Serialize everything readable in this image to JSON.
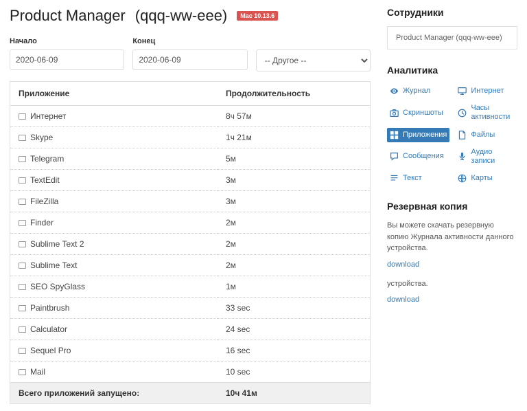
{
  "header": {
    "title": "Product Manager",
    "device_id": "(qqq-ww-eee)",
    "os_badge": "Mac 10.13.6"
  },
  "filters": {
    "start_label": "Начало",
    "start_value": "2020-06-09",
    "end_label": "Конец",
    "end_value": "2020-06-09",
    "other_value": "-- Другое --"
  },
  "table": {
    "col_app": "Приложение",
    "col_duration": "Продолжительность",
    "rows": [
      {
        "app": "Интернет",
        "dur": "8ч 57м"
      },
      {
        "app": "Skype",
        "dur": "1ч 21м"
      },
      {
        "app": "Telegram",
        "dur": "5м"
      },
      {
        "app": "TextEdit",
        "dur": "3м"
      },
      {
        "app": "FileZilla",
        "dur": "3м"
      },
      {
        "app": "Finder",
        "dur": "2м"
      },
      {
        "app": "Sublime Text 2",
        "dur": "2м"
      },
      {
        "app": "Sublime Text",
        "dur": "2м"
      },
      {
        "app": "SEO SpyGlass",
        "dur": "1м"
      },
      {
        "app": "Paintbrush",
        "dur": "33 sec"
      },
      {
        "app": "Calculator",
        "dur": "24 sec"
      },
      {
        "app": "Sequel Pro",
        "dur": "16 sec"
      },
      {
        "app": "Mail",
        "dur": "10 sec"
      }
    ],
    "total_label": "Всего приложений запущено:",
    "total_value": "10ч 41м"
  },
  "sidebar": {
    "employees_title": "Сотрудники",
    "employee_selected": "Product Manager (qqq-ww-eee)",
    "analytics_title": "Аналитика",
    "analytics": [
      {
        "icon": "eye",
        "label": "Журнал"
      },
      {
        "icon": "monitor",
        "label": "Интернет"
      },
      {
        "icon": "camera",
        "label": "Скриншоты"
      },
      {
        "icon": "clock",
        "label": "Часы активности"
      },
      {
        "icon": "grid",
        "label": "Приложения",
        "active": true
      },
      {
        "icon": "file",
        "label": "Файлы"
      },
      {
        "icon": "chat",
        "label": "Сообщения"
      },
      {
        "icon": "mic",
        "label": "Аудио записи"
      },
      {
        "icon": "text",
        "label": "Текст"
      },
      {
        "icon": "globe",
        "label": "Карты"
      }
    ],
    "backup_title": "Резервная копия",
    "backup_text1": "Вы можете скачать резервную копию Журнала активности данного устройства.",
    "backup_link": "download",
    "backup_text2": "устройства."
  }
}
